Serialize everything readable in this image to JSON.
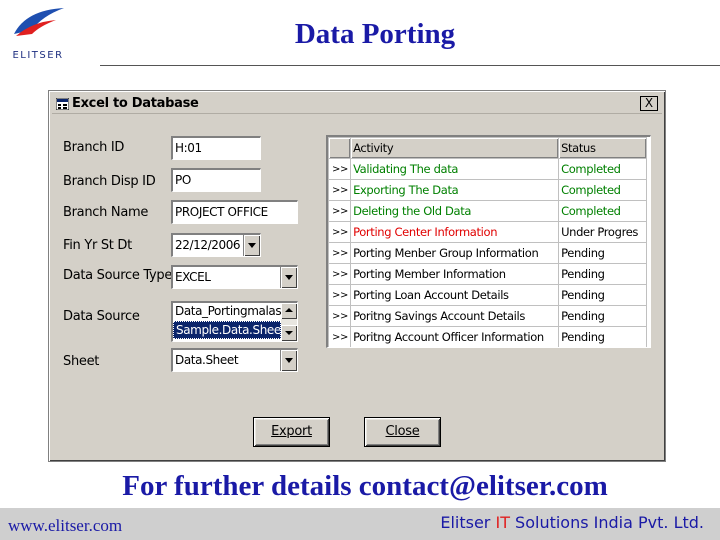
{
  "slide": {
    "title": "Data Porting",
    "logo_text": "ELITSER",
    "contact_line": "For further details contact@elitser.com",
    "footer_url": "www.elitser.com",
    "footer_company_pre": "Elitser ",
    "footer_company_it": "IT",
    "footer_company_post": " Solutions India Pvt. Ltd."
  },
  "window": {
    "title": "Excel to Database",
    "close_glyph": "X"
  },
  "form": {
    "branch_id": {
      "label": "Branch ID",
      "value": "H:01"
    },
    "branch_disp_id": {
      "label": "Branch Disp ID",
      "value": "PO"
    },
    "branch_name": {
      "label": "Branch Name",
      "value": "PROJECT OFFICE"
    },
    "fin_yr_st_dt": {
      "label": "Fin Yr St Dt",
      "value": "22/12/2006"
    },
    "data_source_type": {
      "label": "Data Source Type",
      "value": "EXCEL"
    },
    "data_source": {
      "label": "Data Source",
      "items": [
        "Data_Portingmalas",
        "Sample.Data.Sheet."
      ]
    },
    "sheet": {
      "label": "Sheet",
      "value": "Data.Sheet"
    }
  },
  "grid": {
    "headers": [
      "",
      "Activity",
      "Status"
    ],
    "rows": [
      {
        "marker": ">>",
        "activity": "Validating The data",
        "status": "Completed",
        "color": "#008000"
      },
      {
        "marker": ">>",
        "activity": "Exporting The Data",
        "status": "Completed",
        "color": "#008000"
      },
      {
        "marker": ">>",
        "activity": "Deleting the Old Data",
        "status": "Completed",
        "color": "#008000"
      },
      {
        "marker": ">>",
        "activity": "Porting Center Information",
        "status": "Under Progres",
        "color": "#e00000",
        "status_color": "#000000"
      },
      {
        "marker": ">>",
        "activity": "Porting Menber Group Information",
        "status": "Pending",
        "color": "#000000"
      },
      {
        "marker": ">>",
        "activity": "Porting Member Information",
        "status": "Pending",
        "color": "#000000"
      },
      {
        "marker": ">>",
        "activity": "Porting Loan Account Details",
        "status": "Pending",
        "color": "#000000"
      },
      {
        "marker": ">>",
        "activity": "Poritng Savings Account Details",
        "status": "Pending",
        "color": "#000000"
      },
      {
        "marker": ">>",
        "activity": "Poritng Account Officer Information",
        "status": "Pending",
        "color": "#000000"
      }
    ]
  },
  "buttons": {
    "export": {
      "label": "Export"
    },
    "close": {
      "label": "Close"
    }
  },
  "colors": {
    "completed": "#008000",
    "in_progress": "#e00000",
    "brand_blue": "#1a1aa6",
    "window_face": "#d4d0c8"
  }
}
